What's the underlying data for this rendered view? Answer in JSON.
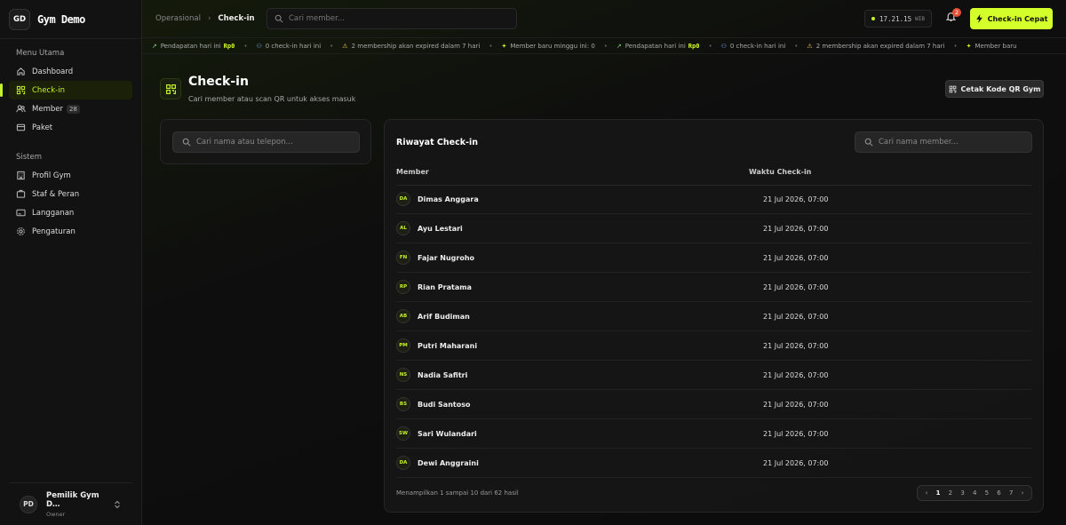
{
  "app": {
    "logo_initials": "GD",
    "name": "Gym Demo"
  },
  "sidebar": {
    "menu_title": "Menu Utama",
    "menu_items": [
      {
        "label": "Dashboard"
      },
      {
        "label": "Check-in"
      },
      {
        "label": "Member",
        "badge": "28"
      },
      {
        "label": "Paket"
      }
    ],
    "system_title": "Sistem",
    "system_items": [
      {
        "label": "Profil Gym"
      },
      {
        "label": "Staf & Peran"
      },
      {
        "label": "Langganan"
      },
      {
        "label": "Pengaturan"
      }
    ],
    "user": {
      "initials": "PD",
      "name": "Pemilik Gym D…",
      "role": "Owner"
    }
  },
  "topbar": {
    "breadcrumb": [
      "Operasional",
      "Check-in"
    ],
    "search_placeholder": "Cari member...",
    "clock": "17.21.15",
    "timezone": "WIB",
    "notification_count": "2",
    "cta_label": "Check-in Cepat",
    "accent": "#d4ff2a"
  },
  "ticker": [
    {
      "icon": "arrow-up-icon",
      "text": "Pendapatan hari ini",
      "bold": "Rp0"
    },
    {
      "icon": "users-icon",
      "text": "0 check-in hari ini",
      "bold": ""
    },
    {
      "icon": "warning-icon",
      "text": "2 membership akan expired dalam 7 hari",
      "bold": ""
    },
    {
      "icon": "sparkle-icon",
      "text": "Member baru minggu ini: 0",
      "bold": ""
    },
    {
      "icon": "arrow-up-icon",
      "text": "Pendapatan hari ini",
      "bold": "Rp0"
    },
    {
      "icon": "users-icon",
      "text": "0 check-in hari ini",
      "bold": ""
    },
    {
      "icon": "warning-icon",
      "text": "2 membership akan expired dalam 7 hari",
      "bold": ""
    },
    {
      "icon": "sparkle-icon",
      "text": "Member baru",
      "bold": ""
    }
  ],
  "page": {
    "title": "Check-in",
    "subtitle": "Cari member atau scan QR untuk akses masuk",
    "print_label": "Cetak Kode QR Gym",
    "left_search_placeholder": "Cari nama atau telepon..."
  },
  "history": {
    "title": "Riwayat Check-in",
    "search_placeholder": "Cari nama member...",
    "columns": [
      "Member",
      "Waktu Check-in"
    ],
    "rows": [
      {
        "initials": "DA",
        "name": "Dimas Anggara",
        "time": "21 Jul 2026, 07:00"
      },
      {
        "initials": "AL",
        "name": "Ayu Lestari",
        "time": "21 Jul 2026, 07:00"
      },
      {
        "initials": "FN",
        "name": "Fajar Nugroho",
        "time": "21 Jul 2026, 07:00"
      },
      {
        "initials": "RP",
        "name": "Rian Pratama",
        "time": "21 Jul 2026, 07:00"
      },
      {
        "initials": "AB",
        "name": "Arif Budiman",
        "time": "21 Jul 2026, 07:00"
      },
      {
        "initials": "PM",
        "name": "Putri Maharani",
        "time": "21 Jul 2026, 07:00"
      },
      {
        "initials": "NS",
        "name": "Nadia Safitri",
        "time": "21 Jul 2026, 07:00"
      },
      {
        "initials": "BS",
        "name": "Budi Santoso",
        "time": "21 Jul 2026, 07:00"
      },
      {
        "initials": "SW",
        "name": "Sari Wulandari",
        "time": "21 Jul 2026, 07:00"
      },
      {
        "initials": "DA",
        "name": "Dewi Anggraini",
        "time": "21 Jul 2026, 07:00"
      }
    ],
    "summary": "Menampilkan 1 sampai 10 dari 62 hasil",
    "pages": [
      "1",
      "2",
      "3",
      "4",
      "5",
      "6",
      "7"
    ],
    "current_page": "1"
  }
}
